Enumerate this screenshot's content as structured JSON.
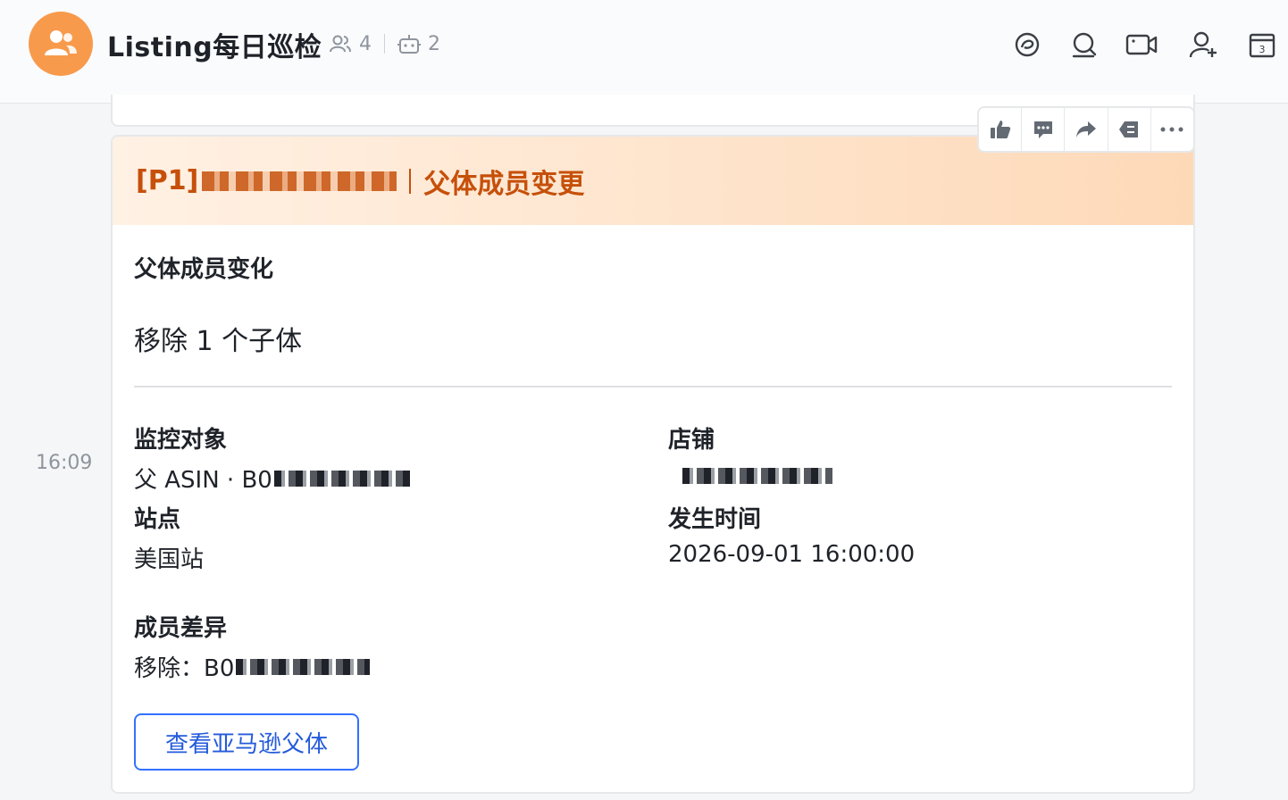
{
  "header": {
    "title": "Listing每日巡检",
    "member_count": "4",
    "bot_count": "2"
  },
  "icons": {
    "avatar": "group-users-icon",
    "members": "members-icon",
    "bots": "bot-icon",
    "toolbar": [
      "chat-bubble-icon",
      "search-icon",
      "video-call-icon",
      "add-member-icon",
      "calendar-icon"
    ],
    "reactions": [
      "thumbs-up-icon",
      "reply-icon",
      "forward-icon",
      "pin-icon",
      "more-icon"
    ]
  },
  "message": {
    "timestamp": "16:09",
    "card": {
      "priority": "[P1]",
      "title_suffix": "父体成员变更",
      "change_section_title": "父体成员变化",
      "change_summary": "移除 1 个子体",
      "monitor_label": "监控对象",
      "monitor_value": "父 ASIN · B0",
      "store_label": "店铺",
      "site_label": "站点",
      "site_value": "美国站",
      "time_label": "发生时间",
      "time_value": "2026-09-01 16:00:00",
      "diff_label": "成员差异",
      "diff_value": "移除：B0",
      "button_label": "查看亚马逊父体"
    }
  },
  "colors": {
    "accent_orange": "#c6500a",
    "avatar_bg": "#f89a4c",
    "link_blue": "#3370ff"
  }
}
